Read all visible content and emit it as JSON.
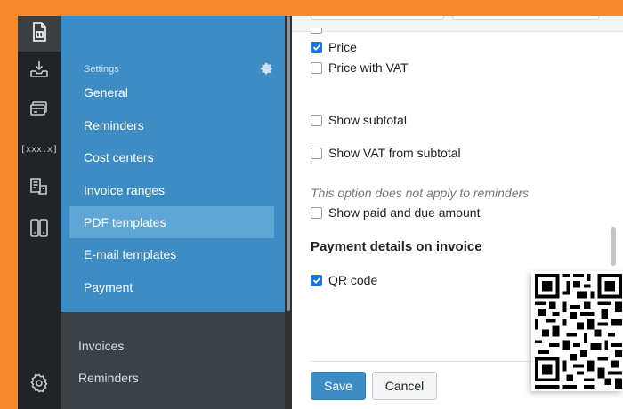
{
  "settings": {
    "heading": "Settings",
    "items": [
      {
        "label": "General"
      },
      {
        "label": "Reminders"
      },
      {
        "label": "Cost centers"
      },
      {
        "label": "Invoice ranges"
      },
      {
        "label": "PDF templates",
        "active": true
      },
      {
        "label": "E-mail templates"
      },
      {
        "label": "Payment"
      }
    ]
  },
  "nav": {
    "items": [
      {
        "label": "Invoices"
      },
      {
        "label": "Reminders"
      }
    ]
  },
  "rail": {
    "items": [
      {
        "icon": "invoice-document-icon",
        "active": true
      },
      {
        "icon": "inbox-download-icon"
      },
      {
        "icon": "credit-card-icon"
      },
      {
        "icon": "variables-icon",
        "text": "[xxx.x]"
      },
      {
        "icon": "documents-transfer-icon"
      },
      {
        "icon": "columns-icon"
      },
      {
        "icon": "gear-icon"
      }
    ]
  },
  "content": {
    "options": [
      {
        "label": "Price",
        "checked": true
      },
      {
        "label": "Price with VAT",
        "checked": false
      },
      {
        "label": "Show subtotal",
        "checked": false
      },
      {
        "label": "Show VAT from subtotal",
        "checked": false
      },
      {
        "label": "Show paid and due amount",
        "checked": false
      }
    ],
    "note": "This option does not apply to reminders",
    "payment_section_title": "Payment details on invoice",
    "qr_option": {
      "label": "QR code",
      "checked": true
    }
  },
  "footer": {
    "save_label": "Save",
    "cancel_label": "Cancel"
  },
  "colors": {
    "frame": "#f58a2c",
    "sidebar_blue": "#3d8dc4",
    "sidebar_active": "#5ea6d5",
    "rail_dark": "#202426",
    "lower_panel": "#3b4145",
    "checkbox_checked": "#1a73e8"
  }
}
